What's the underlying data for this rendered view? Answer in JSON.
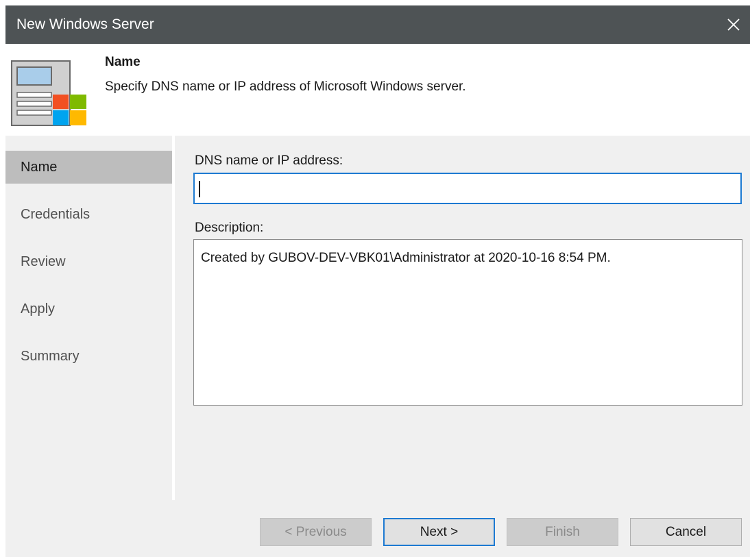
{
  "window": {
    "title": "New Windows Server",
    "close_icon": "close-icon"
  },
  "header": {
    "title": "Name",
    "subtitle": "Specify DNS name or IP address of Microsoft Windows server.",
    "icon": "windows-server-icon"
  },
  "steps": [
    {
      "label": "Name",
      "active": true
    },
    {
      "label": "Credentials",
      "active": false
    },
    {
      "label": "Review",
      "active": false
    },
    {
      "label": "Apply",
      "active": false
    },
    {
      "label": "Summary",
      "active": false
    }
  ],
  "form": {
    "dns_label": "DNS name or IP address:",
    "dns_value": "",
    "description_label": "Description:",
    "description_value": "Created by GUBOV-DEV-VBK01\\Administrator at 2020-10-16 8:54 PM."
  },
  "buttons": {
    "previous": "< Previous",
    "next": "Next >",
    "finish": "Finish",
    "cancel": "Cancel"
  },
  "colors": {
    "titlebar": "#4e5355",
    "accent": "#1d7ad2",
    "panel": "#f0f0f0",
    "active_step": "#bdbdbd"
  }
}
